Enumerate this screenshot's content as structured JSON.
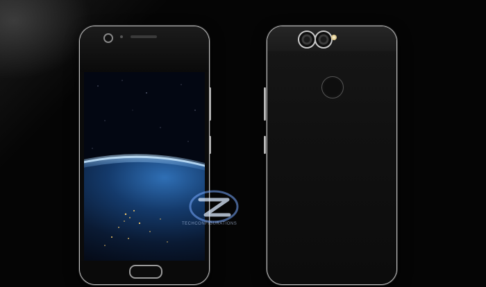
{
  "scene": {
    "description_colors": {
      "background": "#050505",
      "phone_body": "#0b0b0b",
      "frame": "#bdbdbd",
      "earth_glow": "#4a8be0"
    },
    "watermark_text": "TECHCONFIGURATIONS"
  },
  "front_phone": {
    "icons": [
      "front-camera-icon",
      "proximity-sensor-icon",
      "earpiece-speaker-icon",
      "home-button-icon"
    ]
  },
  "back_phone": {
    "icons": [
      "dual-camera-lens-icon",
      "flash-icon",
      "fingerprint-sensor-icon"
    ]
  }
}
